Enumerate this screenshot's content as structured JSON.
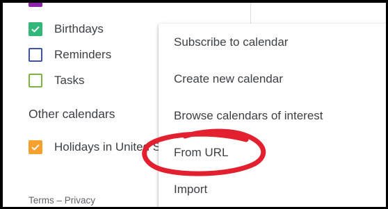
{
  "calendars": {
    "my_calendars": [
      {
        "label": "",
        "checked": true,
        "color": "#8e24aa"
      },
      {
        "label": "Birthdays",
        "checked": true,
        "color": "#33b679"
      },
      {
        "label": "Reminders",
        "checked": false,
        "color": "#3f51b5"
      },
      {
        "label": "Tasks",
        "checked": false,
        "color": "#7cb342"
      }
    ],
    "other_calendars_title": "Other calendars",
    "other_calendars": [
      {
        "label": "Holidays in United States",
        "checked": true,
        "color": "#f6a02d"
      }
    ]
  },
  "footer": {
    "links": "Terms – Privacy"
  },
  "menu": {
    "items": [
      {
        "label": "Subscribe to calendar"
      },
      {
        "label": "Create new calendar"
      },
      {
        "label": "Browse calendars of interest"
      },
      {
        "label": "From URL",
        "highlighted": true
      },
      {
        "label": "Import"
      }
    ]
  },
  "colors": {
    "annotation": "#e3202f",
    "text": "#3c4043"
  }
}
